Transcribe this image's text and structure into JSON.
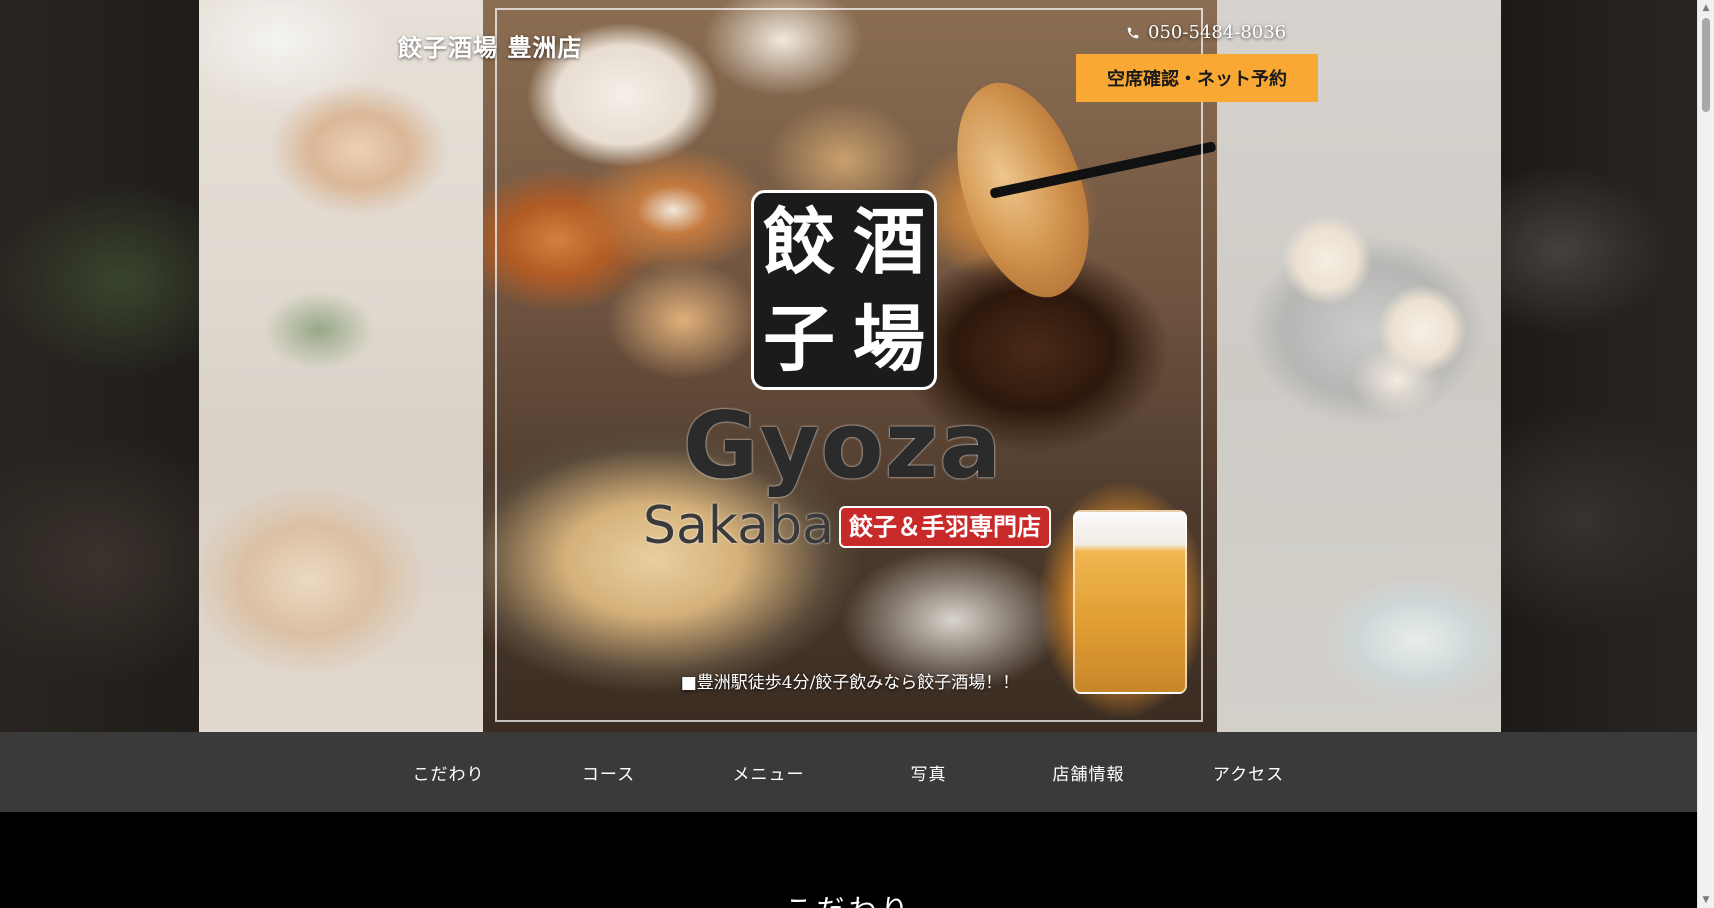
{
  "header": {
    "shop_name": "餃子酒場 豊洲店",
    "phone": "050-5484-8036",
    "phone_icon": "phone-icon",
    "reserve_label": "空席確認・ネット予約",
    "reserve_color": "#f9a833"
  },
  "hero": {
    "logo_chars": [
      "餃",
      "酒",
      "子",
      "場"
    ],
    "brand_main": "Gyoza",
    "brand_sub": "Sakaba",
    "badge": "餃子＆手羽専門店",
    "tagline": "■豊洲駅徒歩4分/餃子飲みなら餃子酒場！！"
  },
  "nav": {
    "items": [
      {
        "label": "こだわり"
      },
      {
        "label": "コース"
      },
      {
        "label": "メニュー"
      },
      {
        "label": "写真"
      },
      {
        "label": "店舗情報"
      },
      {
        "label": "アクセス"
      }
    ],
    "background": "#3a3a3a"
  },
  "section": {
    "title": "こだわり"
  }
}
